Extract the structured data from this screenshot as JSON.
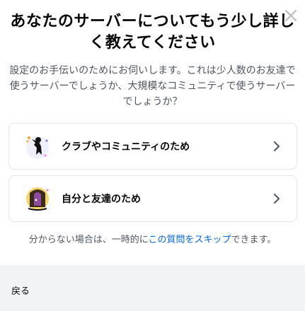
{
  "dialog": {
    "title": "あなたのサーバーについてもう少し詳しく教えてください",
    "subtitle": "設定のお手伝いのためにお伺いします。これは少人数のお友達で使うサーバーでしょうか、大規模なコミュニティで使うサーバーでしょうか？",
    "close_icon": "close-icon"
  },
  "options": [
    {
      "label": "クラブやコミュニティのため",
      "icon": "club-community-art"
    },
    {
      "label": "自分と友達のため",
      "icon": "friends-art"
    }
  ],
  "skip": {
    "prefix": "分からない場合は、一時的に",
    "link": "この質問をスキップ",
    "suffix": "できます。"
  },
  "footer": {
    "back_label": "戻る"
  },
  "colors": {
    "link": "#0068e0",
    "footer_bg": "#f2f3f5",
    "border": "#e3e5e8",
    "muted_text": "#4f5660"
  }
}
